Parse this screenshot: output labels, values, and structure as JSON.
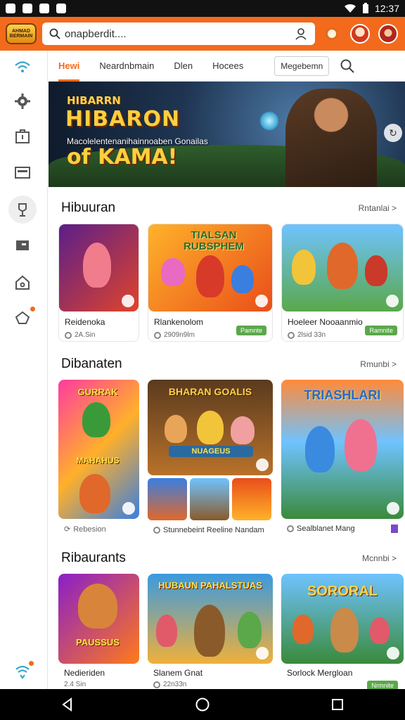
{
  "status_bar": {
    "time": "12:37"
  },
  "app_bar": {
    "logo_text": "AHMAD BERMAIN",
    "search_placeholder": "onapberdit...."
  },
  "tabs": [
    {
      "label": "Hewi",
      "active": true
    },
    {
      "label": "Neardnbmain",
      "active": false
    },
    {
      "label": "Dlen",
      "active": false
    },
    {
      "label": "Hocees",
      "active": false
    }
  ],
  "tab_button": "Megebemn",
  "banner": {
    "title_line1": "HIBARRN",
    "title_line2": "HIBARON",
    "subtitle": "Macolelentenanihainnoaben Gonailas",
    "title_line3": "of KAMA!"
  },
  "sections": [
    {
      "title": "Hibuuran",
      "more": "Rntanlai >",
      "cards": [
        {
          "name": "Reidenoka",
          "meta": "2A.Sin",
          "button": ""
        },
        {
          "name": "Rlankenolom",
          "meta": "2909n9lm",
          "button": "Pamnte"
        },
        {
          "name": "Hoeleer Nooaanmio",
          "meta": "2lsid 33n",
          "button": "Ramnite"
        }
      ]
    },
    {
      "title": "Dibanaten",
      "more": "Rmunbi >",
      "cards": [
        {
          "name": "Rebesion",
          "meta": "",
          "button": ""
        },
        {
          "name": "Stunnebeint Reeline Nandam",
          "meta": "",
          "button": ""
        },
        {
          "name": "Sealblanet Mang",
          "meta": "",
          "button": ""
        }
      ]
    },
    {
      "title": "Ribaurants",
      "more": "Mcnnbi >",
      "cards": [
        {
          "name": "Nedieriden",
          "meta": "2.4 Sin",
          "button": ""
        },
        {
          "name": "Slanem Gnat",
          "meta": "22n33n",
          "button": ""
        },
        {
          "name": "Sorlock Mergloan",
          "meta": "",
          "button": "Nrmnite"
        }
      ]
    }
  ],
  "thumbnail_titles": {
    "s2c1_top": "GURRAK",
    "s2c1_bottom": "MAHAHUS",
    "s2c2_top": "BHARAN GOALIS",
    "s2c2_bottom": "NUAGEUS",
    "s2c3": "TRIASHLARI",
    "s3c1": "PAUSSUS",
    "s3c2": "HUBAUN PAHALSTUAS",
    "s3c3": "SORORAL",
    "s1c2": "TIALSAN RUBSPHEM"
  },
  "colors": {
    "accent": "#f36a1c",
    "play_green": "#5aa84a",
    "status_bar": "#111111",
    "nav_bar": "#000000"
  },
  "icons": [
    "wifi-icon",
    "gear-icon",
    "briefcase-icon",
    "tv-icon",
    "trophy-icon",
    "monitor-icon",
    "home-icon",
    "chat-icon",
    "search-icon",
    "user-icon",
    "back-icon",
    "home-circle-icon",
    "recents-icon"
  ]
}
